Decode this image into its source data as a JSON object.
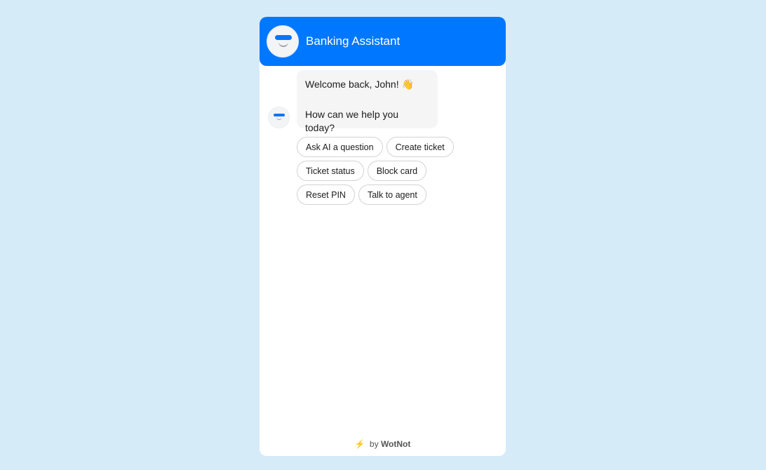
{
  "header": {
    "title": "Banking Assistant",
    "avatar_icon": "bot-avatar-icon"
  },
  "messages": [
    {
      "sender": "bot",
      "lines": [
        "Welcome back, John! 👋",
        "How can we help you today?"
      ]
    }
  ],
  "quick_replies": [
    [
      "Ask AI a question",
      "Create ticket"
    ],
    [
      "Ticket status",
      "Block card"
    ],
    [
      "Reset PIN",
      "Talk to agent"
    ]
  ],
  "footer": {
    "icon": "⚡",
    "prefix": "by",
    "brand": "WotNot"
  },
  "colors": {
    "accent": "#0077ff",
    "background": "#d6ebf8"
  }
}
